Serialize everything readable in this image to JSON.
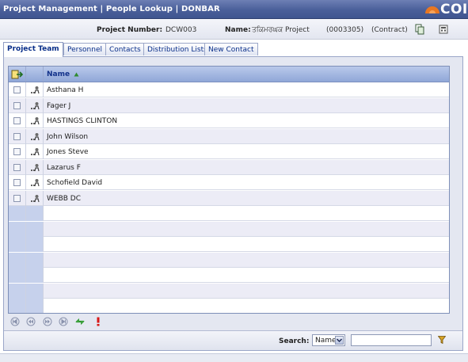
{
  "window": {
    "title": "Project Management | People Lookup | DONBAR",
    "logo_text": "COINS"
  },
  "info": {
    "project_number_label": "Project Number:",
    "project_number_value": "DCW003",
    "name_label": "Name:",
    "name_value": "ਤਕਿਮਰਘਕ Project",
    "code": "(0003305)",
    "status": "(Contract)"
  },
  "tabs": [
    {
      "label": "Project Team",
      "active": true
    },
    {
      "label": "Personnel",
      "active": false
    },
    {
      "label": "Contacts",
      "active": false
    },
    {
      "label": "Distribution Lists",
      "active": false
    },
    {
      "label": "New Contact",
      "active": false
    }
  ],
  "grid": {
    "header": {
      "name_label": "Name",
      "sort_direction": "ascending"
    },
    "rows": [
      {
        "name": "Asthana H"
      },
      {
        "name": "Fager J"
      },
      {
        "name": "HASTINGS CLINTON"
      },
      {
        "name": "John Wilson"
      },
      {
        "name": "Jones Steve"
      },
      {
        "name": "Lazarus F"
      },
      {
        "name": "Schofield David"
      },
      {
        "name": "WEBB DC"
      }
    ],
    "empty_rows": 7
  },
  "pager": {
    "buttons": [
      "first-icon",
      "previous-icon",
      "next-icon",
      "last-icon",
      "refresh-icon",
      "alert-icon"
    ]
  },
  "search": {
    "label": "Search:",
    "field_selected": "Name",
    "value": ""
  },
  "colors": {
    "titlebar": "#4a5f9a",
    "header": "#90a7d8",
    "row_alt": "#ececf6",
    "logo_accent": "#e87722"
  }
}
